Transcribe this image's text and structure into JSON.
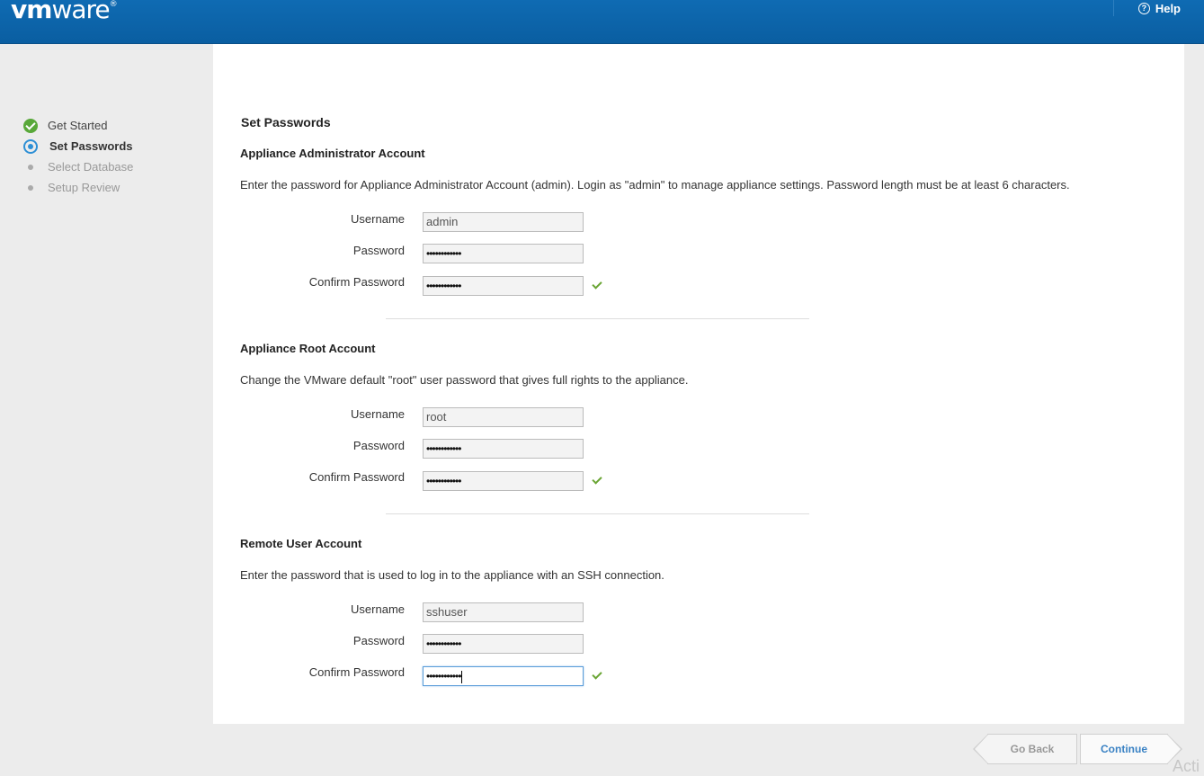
{
  "header": {
    "logo_main": "vm",
    "logo_rest": "ware",
    "logo_reg": "®",
    "help_label": "Help"
  },
  "sidebar": {
    "steps": [
      {
        "label": "Get Started",
        "state": "done"
      },
      {
        "label": "Set Passwords",
        "state": "current"
      },
      {
        "label": "Select Database",
        "state": "pending"
      },
      {
        "label": "Setup Review",
        "state": "pending"
      }
    ]
  },
  "main": {
    "title": "Set Passwords",
    "sections": [
      {
        "title": "Appliance Administrator Account",
        "description": "Enter the password for Appliance Administrator Account (admin). Login as \"admin\" to manage appliance settings. Password length must be at least 6 characters.",
        "username_label": "Username",
        "password_label": "Password",
        "confirm_label": "Confirm Password",
        "username": "admin",
        "password": "••••••••••••",
        "confirm": "••••••••••••"
      },
      {
        "title": "Appliance Root Account",
        "description": "Change the VMware default \"root\" user password that gives full rights to the appliance.",
        "username_label": "Username",
        "password_label": "Password",
        "confirm_label": "Confirm Password",
        "username": "root",
        "password": "••••••••••••",
        "confirm": "••••••••••••"
      },
      {
        "title": "Remote User Account",
        "description": "Enter the password that is used to log in to the appliance with an SSH connection.",
        "username_label": "Username",
        "password_label": "Password",
        "confirm_label": "Confirm Password",
        "username": "sshuser",
        "password": "••••••••••••",
        "confirm": "••••••••••••"
      }
    ]
  },
  "footer": {
    "back_label": "Go Back",
    "continue_label": "Continue"
  },
  "watermark": "Acti",
  "colors": {
    "header": "#0a5ea1",
    "success": "#58a839",
    "current": "#2d8fd5",
    "link": "#3a82c4"
  }
}
